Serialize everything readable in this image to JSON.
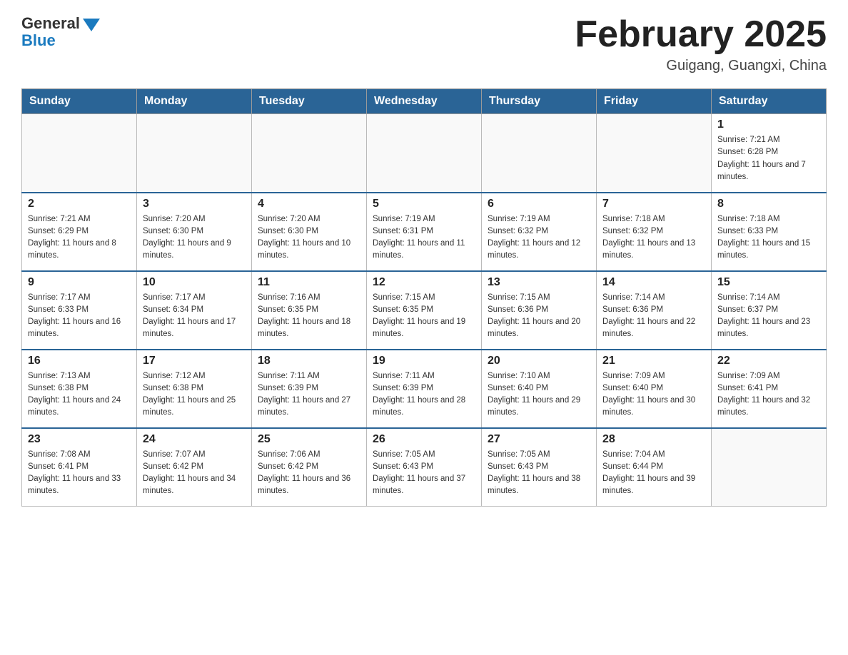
{
  "header": {
    "logo_general": "General",
    "logo_blue": "Blue",
    "month_title": "February 2025",
    "location": "Guigang, Guangxi, China"
  },
  "days_of_week": [
    "Sunday",
    "Monday",
    "Tuesday",
    "Wednesday",
    "Thursday",
    "Friday",
    "Saturday"
  ],
  "weeks": [
    [
      {
        "day": "",
        "sunrise": "",
        "sunset": "",
        "daylight": ""
      },
      {
        "day": "",
        "sunrise": "",
        "sunset": "",
        "daylight": ""
      },
      {
        "day": "",
        "sunrise": "",
        "sunset": "",
        "daylight": ""
      },
      {
        "day": "",
        "sunrise": "",
        "sunset": "",
        "daylight": ""
      },
      {
        "day": "",
        "sunrise": "",
        "sunset": "",
        "daylight": ""
      },
      {
        "day": "",
        "sunrise": "",
        "sunset": "",
        "daylight": ""
      },
      {
        "day": "1",
        "sunrise": "Sunrise: 7:21 AM",
        "sunset": "Sunset: 6:28 PM",
        "daylight": "Daylight: 11 hours and 7 minutes."
      }
    ],
    [
      {
        "day": "2",
        "sunrise": "Sunrise: 7:21 AM",
        "sunset": "Sunset: 6:29 PM",
        "daylight": "Daylight: 11 hours and 8 minutes."
      },
      {
        "day": "3",
        "sunrise": "Sunrise: 7:20 AM",
        "sunset": "Sunset: 6:30 PM",
        "daylight": "Daylight: 11 hours and 9 minutes."
      },
      {
        "day": "4",
        "sunrise": "Sunrise: 7:20 AM",
        "sunset": "Sunset: 6:30 PM",
        "daylight": "Daylight: 11 hours and 10 minutes."
      },
      {
        "day": "5",
        "sunrise": "Sunrise: 7:19 AM",
        "sunset": "Sunset: 6:31 PM",
        "daylight": "Daylight: 11 hours and 11 minutes."
      },
      {
        "day": "6",
        "sunrise": "Sunrise: 7:19 AM",
        "sunset": "Sunset: 6:32 PM",
        "daylight": "Daylight: 11 hours and 12 minutes."
      },
      {
        "day": "7",
        "sunrise": "Sunrise: 7:18 AM",
        "sunset": "Sunset: 6:32 PM",
        "daylight": "Daylight: 11 hours and 13 minutes."
      },
      {
        "day": "8",
        "sunrise": "Sunrise: 7:18 AM",
        "sunset": "Sunset: 6:33 PM",
        "daylight": "Daylight: 11 hours and 15 minutes."
      }
    ],
    [
      {
        "day": "9",
        "sunrise": "Sunrise: 7:17 AM",
        "sunset": "Sunset: 6:33 PM",
        "daylight": "Daylight: 11 hours and 16 minutes."
      },
      {
        "day": "10",
        "sunrise": "Sunrise: 7:17 AM",
        "sunset": "Sunset: 6:34 PM",
        "daylight": "Daylight: 11 hours and 17 minutes."
      },
      {
        "day": "11",
        "sunrise": "Sunrise: 7:16 AM",
        "sunset": "Sunset: 6:35 PM",
        "daylight": "Daylight: 11 hours and 18 minutes."
      },
      {
        "day": "12",
        "sunrise": "Sunrise: 7:15 AM",
        "sunset": "Sunset: 6:35 PM",
        "daylight": "Daylight: 11 hours and 19 minutes."
      },
      {
        "day": "13",
        "sunrise": "Sunrise: 7:15 AM",
        "sunset": "Sunset: 6:36 PM",
        "daylight": "Daylight: 11 hours and 20 minutes."
      },
      {
        "day": "14",
        "sunrise": "Sunrise: 7:14 AM",
        "sunset": "Sunset: 6:36 PM",
        "daylight": "Daylight: 11 hours and 22 minutes."
      },
      {
        "day": "15",
        "sunrise": "Sunrise: 7:14 AM",
        "sunset": "Sunset: 6:37 PM",
        "daylight": "Daylight: 11 hours and 23 minutes."
      }
    ],
    [
      {
        "day": "16",
        "sunrise": "Sunrise: 7:13 AM",
        "sunset": "Sunset: 6:38 PM",
        "daylight": "Daylight: 11 hours and 24 minutes."
      },
      {
        "day": "17",
        "sunrise": "Sunrise: 7:12 AM",
        "sunset": "Sunset: 6:38 PM",
        "daylight": "Daylight: 11 hours and 25 minutes."
      },
      {
        "day": "18",
        "sunrise": "Sunrise: 7:11 AM",
        "sunset": "Sunset: 6:39 PM",
        "daylight": "Daylight: 11 hours and 27 minutes."
      },
      {
        "day": "19",
        "sunrise": "Sunrise: 7:11 AM",
        "sunset": "Sunset: 6:39 PM",
        "daylight": "Daylight: 11 hours and 28 minutes."
      },
      {
        "day": "20",
        "sunrise": "Sunrise: 7:10 AM",
        "sunset": "Sunset: 6:40 PM",
        "daylight": "Daylight: 11 hours and 29 minutes."
      },
      {
        "day": "21",
        "sunrise": "Sunrise: 7:09 AM",
        "sunset": "Sunset: 6:40 PM",
        "daylight": "Daylight: 11 hours and 30 minutes."
      },
      {
        "day": "22",
        "sunrise": "Sunrise: 7:09 AM",
        "sunset": "Sunset: 6:41 PM",
        "daylight": "Daylight: 11 hours and 32 minutes."
      }
    ],
    [
      {
        "day": "23",
        "sunrise": "Sunrise: 7:08 AM",
        "sunset": "Sunset: 6:41 PM",
        "daylight": "Daylight: 11 hours and 33 minutes."
      },
      {
        "day": "24",
        "sunrise": "Sunrise: 7:07 AM",
        "sunset": "Sunset: 6:42 PM",
        "daylight": "Daylight: 11 hours and 34 minutes."
      },
      {
        "day": "25",
        "sunrise": "Sunrise: 7:06 AM",
        "sunset": "Sunset: 6:42 PM",
        "daylight": "Daylight: 11 hours and 36 minutes."
      },
      {
        "day": "26",
        "sunrise": "Sunrise: 7:05 AM",
        "sunset": "Sunset: 6:43 PM",
        "daylight": "Daylight: 11 hours and 37 minutes."
      },
      {
        "day": "27",
        "sunrise": "Sunrise: 7:05 AM",
        "sunset": "Sunset: 6:43 PM",
        "daylight": "Daylight: 11 hours and 38 minutes."
      },
      {
        "day": "28",
        "sunrise": "Sunrise: 7:04 AM",
        "sunset": "Sunset: 6:44 PM",
        "daylight": "Daylight: 11 hours and 39 minutes."
      },
      {
        "day": "",
        "sunrise": "",
        "sunset": "",
        "daylight": ""
      }
    ]
  ]
}
